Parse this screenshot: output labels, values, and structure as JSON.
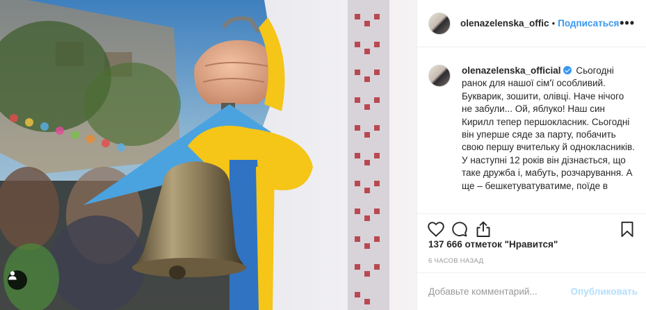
{
  "post": {
    "username_header": "olenazelenska_offic",
    "separator": "•",
    "follow_label": "Подписаться",
    "more_label": "•••",
    "caption_username": "olenazelenska_official",
    "caption_text": "Сьогодні ранок для нашої сім'ї особливий. Букварик, зошити, олівці. Наче нічого не забули... Ой, яблуко! Наш син Кирилл тепер першокласник. Сьогодні він уперше сяде за парту, побачить свою першу вчительку й однокласників. У наступні 12 років він дізнається, що таке дружба і, мабуть, розчарування. А ще – бешкетуватуватиме, поїде в",
    "likes": "137 666 отметок \"Нравится\"",
    "time": "6 часов назад",
    "comment_placeholder": "Добавьте комментарий...",
    "publish_label": "Опубликовать"
  },
  "icons": {
    "like": "heart-icon",
    "comment": "comment-icon",
    "share": "share-icon",
    "save": "bookmark-icon",
    "tagged": "user-tag-icon",
    "verified": "verified-badge-icon"
  },
  "colors": {
    "link_blue": "#3897f0",
    "publish_disabled": "#b2dffc",
    "muted_text": "#999999",
    "ribbon_blue": "#4aa3df",
    "ribbon_yellow": "#f5c518"
  }
}
